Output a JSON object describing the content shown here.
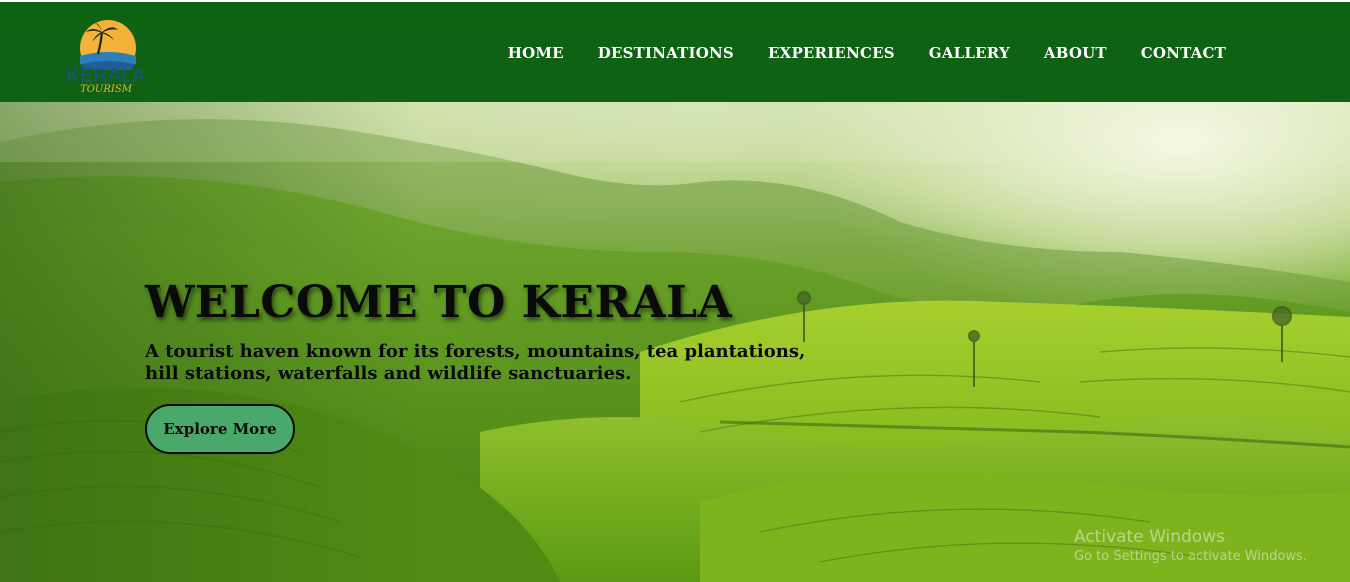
{
  "brand": {
    "logo_text": "KERALA",
    "logo_subtext": "TOURISM"
  },
  "nav": {
    "items": [
      {
        "label": "HOME"
      },
      {
        "label": "DESTINATIONS"
      },
      {
        "label": "EXPERIENCES"
      },
      {
        "label": "GALLERY"
      },
      {
        "label": "ABOUT"
      },
      {
        "label": "CONTACT"
      }
    ]
  },
  "hero": {
    "title": "WELCOME TO KERALA",
    "subtitle": "A tourist haven known for its forests, mountains, tea plantations, hill stations, waterfalls and wildlife sanctuaries.",
    "cta_label": "Explore More"
  },
  "watermark": {
    "title": "Activate Windows",
    "subtitle": "Go to Settings to activate Windows."
  },
  "colors": {
    "navbar_bg": "#0f6114",
    "nav_text": "#ffffff",
    "cta_bg": "#4aa86a",
    "hero_text": "#0a0a0a",
    "logo_sun": "#f4b338",
    "logo_water": "#2a7fb8"
  }
}
